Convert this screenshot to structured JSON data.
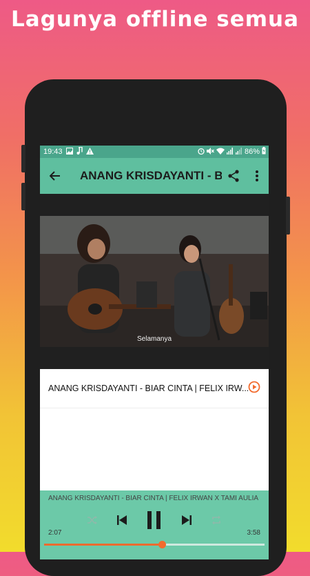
{
  "promo_text": "Lagunya offline semua",
  "status_bar": {
    "time": "19:43",
    "battery": "86%"
  },
  "toolbar": {
    "title": "ANANG KRISDAYANTI - B..."
  },
  "video": {
    "caption": "Selamanya"
  },
  "track_list": [
    {
      "title": "ANANG KRISDAYANTI - BIAR CINTA | FELIX IRW..."
    }
  ],
  "player": {
    "now_playing": "ANANG KRISDAYANTI - BIAR CINTA | FELIX IRWAN X TAMI AULIA",
    "elapsed": "2:07",
    "duration": "3:58",
    "progress": 0.533
  },
  "colors": {
    "accent": "#f26b2e",
    "toolbar": "#5fbf9f",
    "statusbar": "#4aa58b",
    "player": "#6cc9a8"
  }
}
